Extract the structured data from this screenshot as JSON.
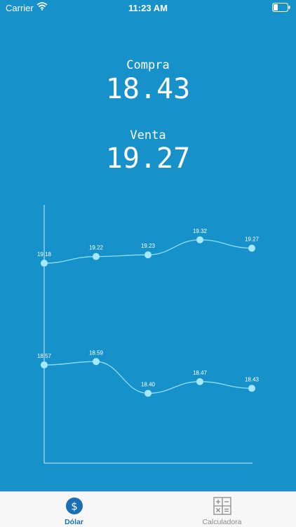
{
  "status_bar": {
    "carrier": "Carrier",
    "time": "11:23 AM"
  },
  "compra": {
    "label": "Compra",
    "value": "18.43"
  },
  "venta": {
    "label": "Venta",
    "value": "19.27"
  },
  "chart_data": {
    "type": "line",
    "categories": [
      "",
      "",
      "",
      "",
      ""
    ],
    "series": [
      {
        "values": [
          19.18,
          19.22,
          19.23,
          19.32,
          19.27
        ],
        "labels": [
          "19.18",
          "19.22",
          "19.23",
          "19.32",
          "19.27"
        ]
      },
      {
        "values": [
          18.57,
          18.59,
          18.4,
          18.47,
          18.43
        ],
        "labels": [
          "18.57",
          "18.59",
          "18.40",
          "18.47",
          "18.43"
        ]
      }
    ],
    "ylim": [
      18.2,
      19.42
    ],
    "colors": {
      "line": "#8fe0ff",
      "point": "#a6e8ff",
      "axis": "#cfeaf6",
      "label": "#ffffff"
    }
  },
  "tabbar": {
    "tabs": [
      {
        "label": "Dólar",
        "icon": "dollar-icon",
        "active": true
      },
      {
        "label": "Calculadora",
        "icon": "calculator-icon",
        "active": false
      }
    ]
  },
  "colors": {
    "background": "#1791c9",
    "tab_active": "#1a6fb5",
    "tab_inactive": "#8a8a8a"
  }
}
